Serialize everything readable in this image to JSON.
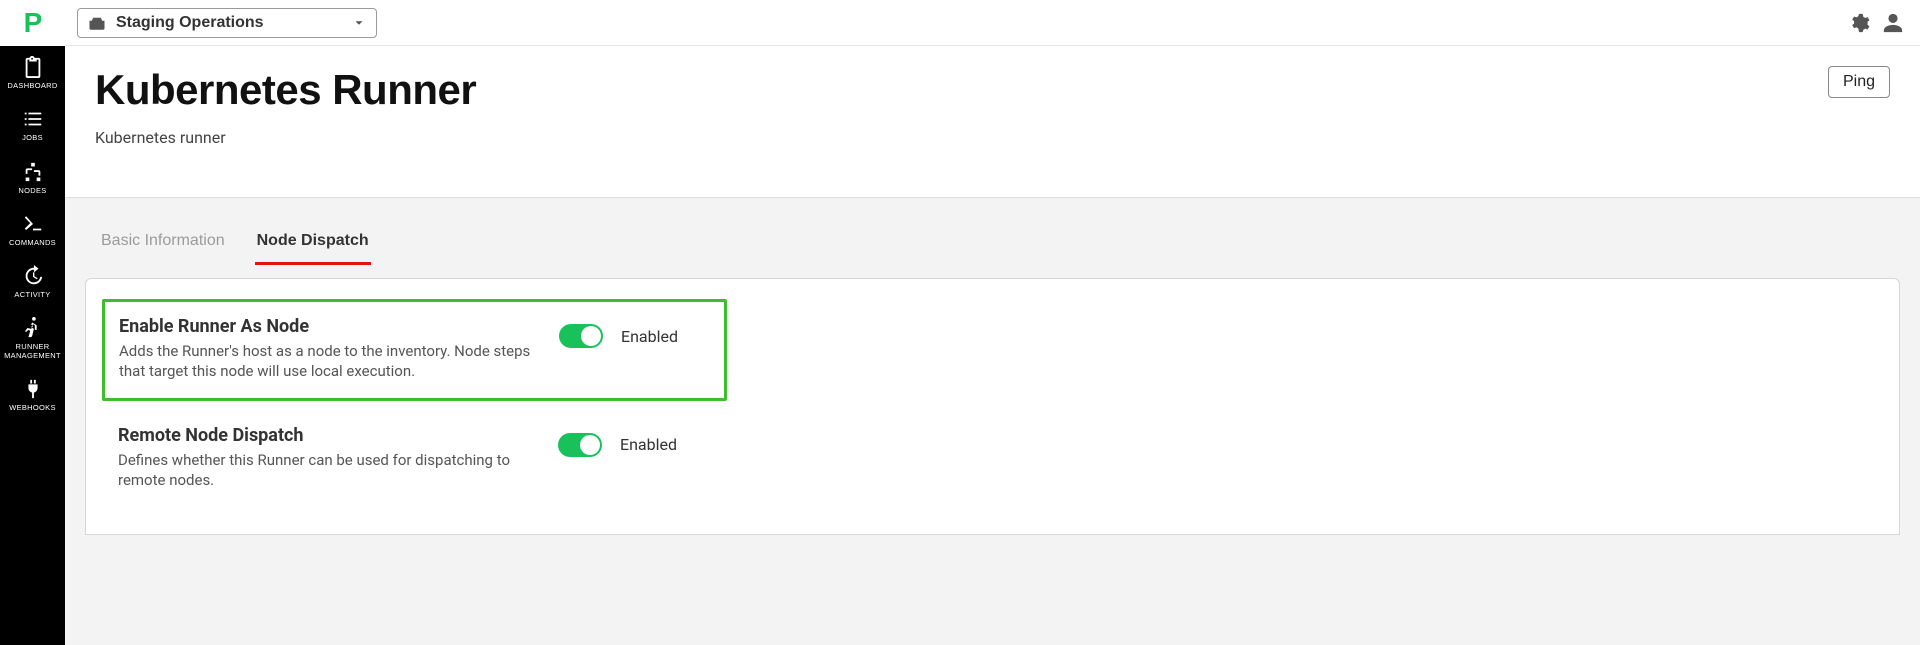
{
  "brand": {
    "letter": "P"
  },
  "sidebar": {
    "items": [
      {
        "label": "DASHBOARD",
        "icon": "clipboard"
      },
      {
        "label": "JOBS",
        "icon": "list-check"
      },
      {
        "label": "NODES",
        "icon": "sitemap"
      },
      {
        "label": "COMMANDS",
        "icon": "terminal"
      },
      {
        "label": "ACTIVITY",
        "icon": "history"
      },
      {
        "label": "RUNNER MANAGEMENT",
        "icon": "running"
      },
      {
        "label": "WEBHOOKS",
        "icon": "plug"
      }
    ]
  },
  "topbar": {
    "project_name": "Staging Operations"
  },
  "header": {
    "title": "Kubernetes Runner",
    "subtitle": "Kubernetes runner",
    "ping_label": "Ping"
  },
  "tabs": [
    {
      "label": "Basic Information",
      "active": false
    },
    {
      "label": "Node Dispatch",
      "active": true
    }
  ],
  "settings": [
    {
      "title": "Enable Runner As Node",
      "description": "Adds the Runner's host as a node to the inventory. Node steps that target this node will use local execution.",
      "state_label": "Enabled",
      "highlight": true
    },
    {
      "title": "Remote Node Dispatch",
      "description": "Defines whether this Runner can be used for dispatching to remote nodes.",
      "state_label": "Enabled",
      "highlight": false
    }
  ]
}
